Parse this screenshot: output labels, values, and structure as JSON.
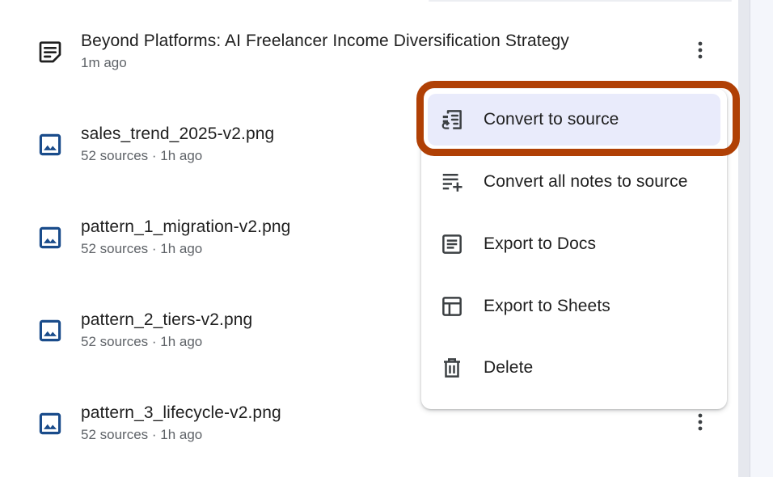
{
  "notes": [
    {
      "title": "Beyond Platforms: AI Freelancer Income Diversification Strategy",
      "meta": "1m ago",
      "icon": "note-icon"
    },
    {
      "title": "sales_trend_2025-v2.png",
      "meta": "52 sources · 1h ago",
      "icon": "image-icon"
    },
    {
      "title": "pattern_1_migration-v2.png",
      "meta": "52 sources · 1h ago",
      "icon": "image-icon"
    },
    {
      "title": "pattern_2_tiers-v2.png",
      "meta": "52 sources · 1h ago",
      "icon": "image-icon"
    },
    {
      "title": "pattern_3_lifecycle-v2.png",
      "meta": "52 sources · 1h ago",
      "icon": "image-icon"
    }
  ],
  "menu": {
    "items": [
      {
        "label": "Convert to source",
        "icon": "convert-to-source-icon",
        "highlighted": true
      },
      {
        "label": "Convert all notes to source",
        "icon": "playlist-add-icon"
      },
      {
        "label": "Export to Docs",
        "icon": "docs-icon"
      },
      {
        "label": "Export to Sheets",
        "icon": "sheets-icon"
      },
      {
        "label": "Delete",
        "icon": "trash-icon"
      }
    ]
  },
  "colors": {
    "icon_blue": "#1a4c8b",
    "text": "#1f1f1f",
    "meta_text": "#5f6368",
    "highlight_bg": "#e9ebfb",
    "focus_ring": "#b04005"
  }
}
